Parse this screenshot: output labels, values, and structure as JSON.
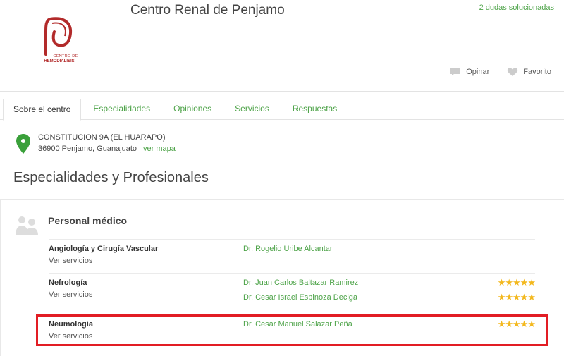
{
  "header": {
    "logo_line1": "CENTRO DE",
    "logo_line2": "HEMODIALISIS",
    "title": "Centro Renal de Penjamo",
    "answers_link": "2 dudas solucionadas",
    "actions": {
      "review": "Opinar",
      "favorite": "Favorito"
    }
  },
  "tabs": [
    {
      "label": "Sobre el centro",
      "active": true
    },
    {
      "label": "Especialidades",
      "active": false
    },
    {
      "label": "Opiniones",
      "active": false
    },
    {
      "label": "Servicios",
      "active": false
    },
    {
      "label": "Respuestas",
      "active": false
    }
  ],
  "address": {
    "line1": "CONSTITUCION 9A (EL HUARAPO)",
    "line2": "36900 Penjamo, Guanajuato",
    "separator": "|",
    "map_link": "ver mapa"
  },
  "section_title": "Especialidades y Profesionales",
  "personal": {
    "title": "Personal médico",
    "specialties": [
      {
        "name": "Angiología y Cirugía Vascular",
        "services": "Ver servicios",
        "doctors": [
          {
            "name": "Dr. Rogelio Uribe Alcantar",
            "stars": ""
          }
        ]
      },
      {
        "name": "Nefrología",
        "services": "Ver servicios",
        "doctors": [
          {
            "name": "Dr. Juan Carlos Baltazar Ramirez",
            "stars": "★★★★★"
          },
          {
            "name": "Dr. Cesar Israel Espinoza Deciga",
            "stars": "★★★★★"
          }
        ]
      },
      {
        "name": "Neumología",
        "services": "Ver servicios",
        "doctors": [
          {
            "name": "Dr. Cesar Manuel Salazar Peña",
            "stars": "★★★★★"
          }
        ]
      }
    ]
  },
  "colors": {
    "accent_green": "#4da348",
    "star_gold": "#f3b81d",
    "logo_red": "#b22a2a",
    "highlight_red": "#e21d24"
  }
}
